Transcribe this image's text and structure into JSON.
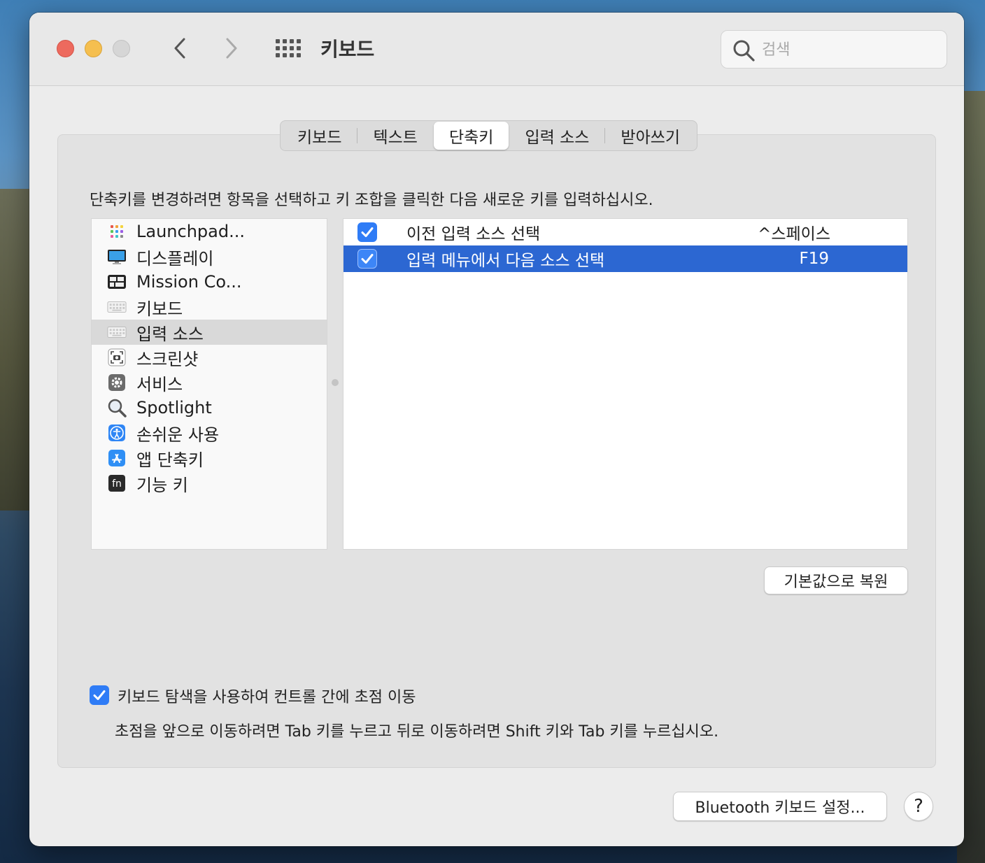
{
  "window": {
    "title": "키보드",
    "search_placeholder": "검색"
  },
  "tabs": [
    {
      "label": "키보드",
      "active": false
    },
    {
      "label": "텍스트",
      "active": false
    },
    {
      "label": "단축키",
      "active": true
    },
    {
      "label": "입력 소스",
      "active": false
    },
    {
      "label": "받아쓰기",
      "active": false
    }
  ],
  "instruction": "단축키를 변경하려면 항목을 선택하고 키 조합을 클릭한 다음 새로운 키를 입력하십시오.",
  "sidebar": {
    "items": [
      {
        "label": "Launchpad...",
        "icon": "launchpad-icon",
        "selected": false
      },
      {
        "label": "디스플레이",
        "icon": "display-icon",
        "selected": false
      },
      {
        "label": "Mission Co...",
        "icon": "mission-control-icon",
        "selected": false
      },
      {
        "label": "키보드",
        "icon": "keyboard-icon",
        "selected": false
      },
      {
        "label": "입력 소스",
        "icon": "input-sources-icon",
        "selected": true
      },
      {
        "label": "스크린샷",
        "icon": "screenshot-icon",
        "selected": false
      },
      {
        "label": "서비스",
        "icon": "services-gear-icon",
        "selected": false
      },
      {
        "label": "Spotlight",
        "icon": "spotlight-icon",
        "selected": false
      },
      {
        "label": "손쉬운 사용",
        "icon": "accessibility-icon",
        "selected": false
      },
      {
        "label": "앱 단축키",
        "icon": "app-store-icon",
        "selected": false
      },
      {
        "label": "기능 키",
        "icon": "fn-key-icon",
        "selected": false
      }
    ]
  },
  "shortcuts": [
    {
      "label": "이전 입력 소스 선택",
      "key": "^스페이스",
      "checked": true,
      "selected": false
    },
    {
      "label": "입력 메뉴에서 다음 소스 선택",
      "key": "F19",
      "checked": true,
      "selected": true
    }
  ],
  "restore_button": "기본값으로 복원",
  "keyboard_navigation": {
    "label": "키보드 탐색을 사용하여 컨트롤 간에 초점 이동",
    "checked": true,
    "help": "초점을 앞으로 이동하려면 Tab 키를 누르고 뒤로 이동하려면 Shift 키와 Tab 키를 누르십시오."
  },
  "bluetooth_button": "Bluetooth 키보드 설정...",
  "help_button": "?",
  "colors": {
    "selection_blue": "#2c67d2",
    "checkbox_blue": "#2f7cf6",
    "close": "#ed6a5e",
    "minimize": "#f5bf4f"
  }
}
